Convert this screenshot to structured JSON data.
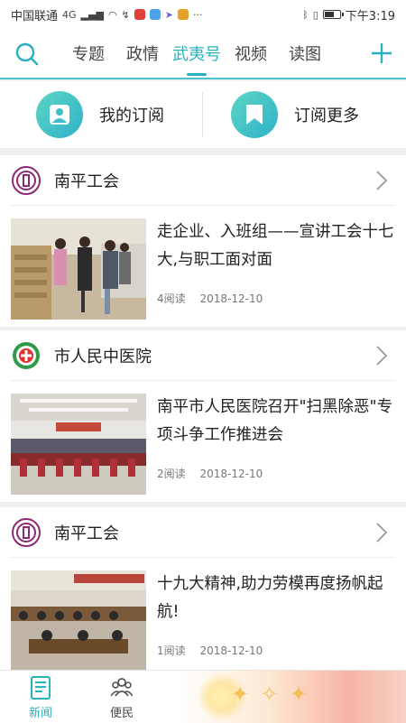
{
  "status_bar": {
    "carrier": "中国联通",
    "network": "4G",
    "time": "下午3:19",
    "battery_level": 0.75
  },
  "top_nav": {
    "tabs": [
      {
        "label": "专题",
        "active": false
      },
      {
        "label": "政情",
        "active": false
      },
      {
        "label": "武夷号",
        "active": true
      },
      {
        "label": "视频",
        "active": false
      },
      {
        "label": "读图",
        "active": false
      }
    ],
    "accent_color": "#2ab1c0"
  },
  "subscriptions": {
    "my_label": "我的订阅",
    "more_label": "订阅更多"
  },
  "cards": [
    {
      "source": "南平工会",
      "source_icon": "union-emblem-icon",
      "title": "走企业、入班组——宣讲工会十七大,与职工面对面",
      "reads": "4阅读",
      "date": "2018-12-10"
    },
    {
      "source": "市人民中医院",
      "source_icon": "hospital-emblem-icon",
      "title": "南平市人民医院召开\"扫黑除恶\"专项斗争工作推进会",
      "reads": "2阅读",
      "date": "2018-12-10"
    },
    {
      "source": "南平工会",
      "source_icon": "union-emblem-icon",
      "title": "十九大精神,助力劳模再度扬帆起航!",
      "reads": "1阅读",
      "date": "2018-12-10"
    }
  ],
  "bottom_nav": {
    "items": [
      {
        "label": "新闻",
        "icon": "news-icon",
        "active": true
      },
      {
        "label": "便民",
        "icon": "people-icon",
        "active": false
      }
    ]
  }
}
